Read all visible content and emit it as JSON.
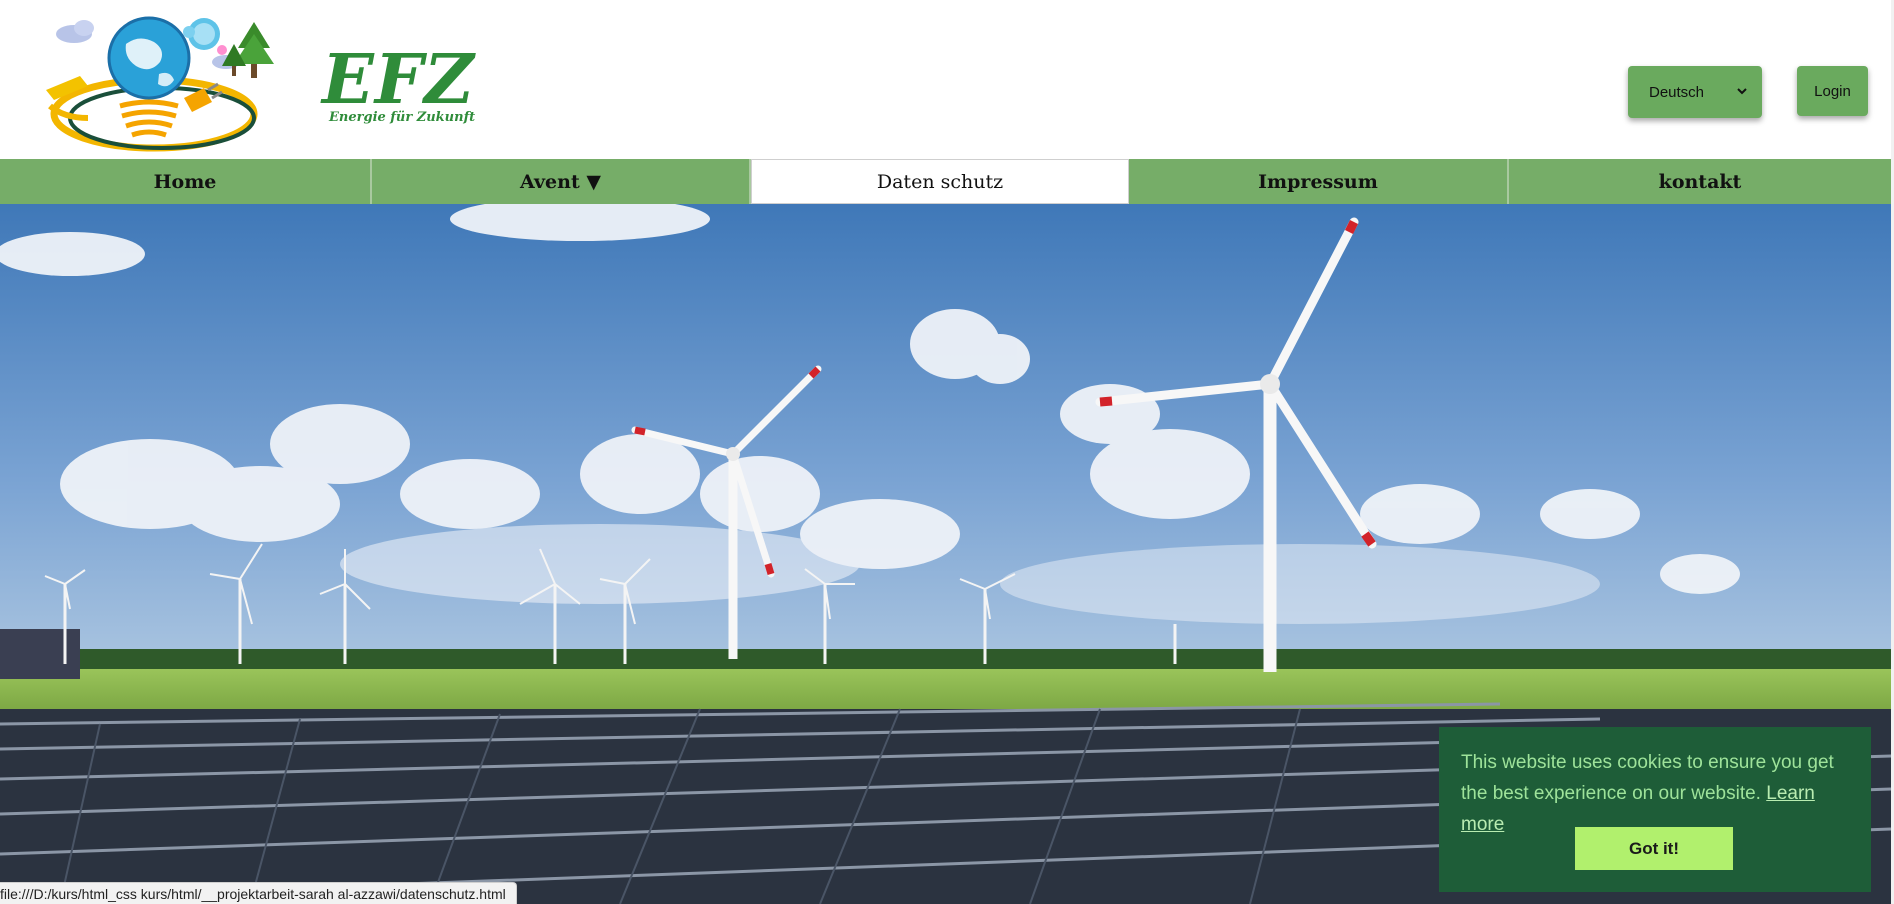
{
  "header": {
    "brand_name": "EFZ",
    "brand_tagline": "Energie für Zukunft",
    "language_selected": "Deutsch",
    "login_label": "Login"
  },
  "nav": {
    "items": [
      {
        "label": "Home"
      },
      {
        "label": "Avent ▼"
      },
      {
        "label": "Daten schutz",
        "active": true
      },
      {
        "label": "Impressum"
      },
      {
        "label": "kontakt"
      }
    ]
  },
  "cookie": {
    "message": "This website uses cookies to ensure you get the best experience on our website.",
    "learn_more": "Learn more",
    "button": "Got it!"
  },
  "status_bar": {
    "url": "file:///D:/kurs/html_css kurs/html/__projektarbeit-sarah al-azzawi/datenschutz.html"
  },
  "colors": {
    "brand_green": "#2f8c3a",
    "nav_green": "#76ad68",
    "button_green": "#6aaa5e",
    "cookie_bg": "#1e5d38",
    "cookie_button": "#b1f06d"
  },
  "icons": {
    "logo": "globe-lightbulb-logo",
    "select_chevron": "chevron-down-icon"
  }
}
